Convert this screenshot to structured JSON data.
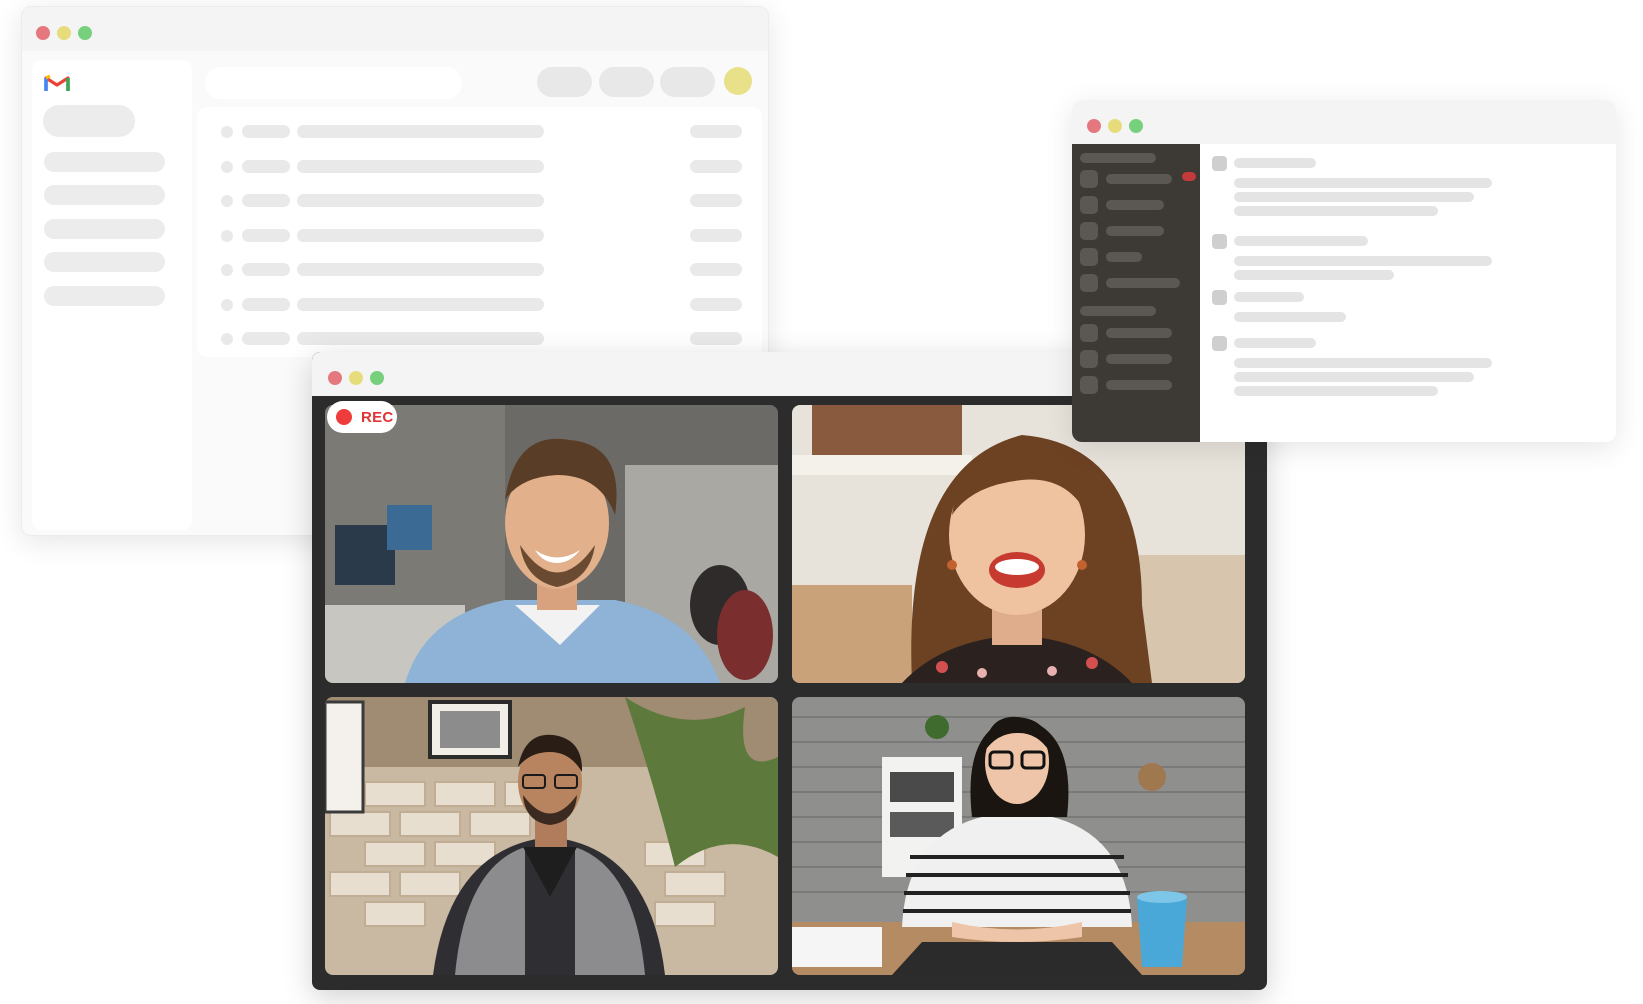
{
  "gmail_window": {
    "app": "Gmail",
    "logo_icon": "gmail-logo-icon",
    "avatar_color": "#e9e08a"
  },
  "chat_window": {
    "unread_color": "#c33a3a"
  },
  "video_call": {
    "recording_label": "REC",
    "recording_color": "#ee3b3b",
    "participants": [
      {
        "tile": "participant-1",
        "description_icon": "man-smiling-office"
      },
      {
        "tile": "participant-2",
        "description_icon": "woman-laughing"
      },
      {
        "tile": "participant-3",
        "description_icon": "man-glasses-plaid"
      },
      {
        "tile": "participant-4",
        "description_icon": "woman-glasses-desk"
      }
    ]
  },
  "window_controls": {
    "close_color": "#e5787f",
    "minimize_color": "#e7dc7b",
    "maximize_color": "#77d07c"
  }
}
